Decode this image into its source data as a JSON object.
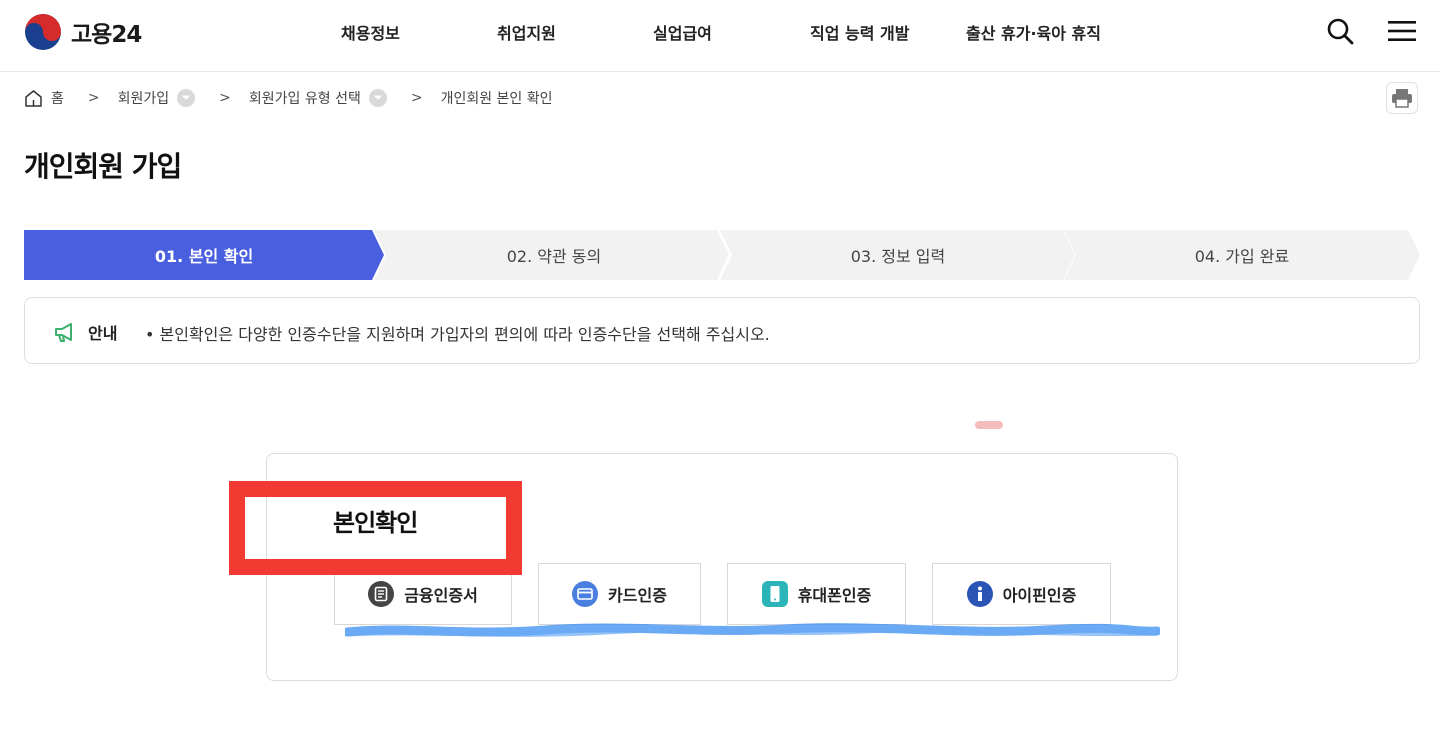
{
  "header": {
    "logo_text": "고용24",
    "nav": [
      {
        "label": "채용정보"
      },
      {
        "label": "취업지원"
      },
      {
        "label": "실업급여"
      },
      {
        "label": "직업 능력 개발"
      },
      {
        "label": "출산 휴가·육아 휴직"
      }
    ],
    "search_icon": "search-icon",
    "menu_icon": "hamburger-menu-icon"
  },
  "breadcrumb": {
    "home": "홈",
    "items": [
      {
        "label": "회원가입"
      },
      {
        "label": "회원가입 유형 선택"
      },
      {
        "label": "개인회원 본인 확인"
      }
    ]
  },
  "page": {
    "title": "개인회원 가입"
  },
  "steps": [
    {
      "label": "01. 본인 확인",
      "active": true
    },
    {
      "label": "02. 약관 동의",
      "active": false
    },
    {
      "label": "03. 정보 입력",
      "active": false
    },
    {
      "label": "04. 가입 완료",
      "active": false
    }
  ],
  "notice": {
    "label": "안내",
    "text": "• 본인확인은 다양한 인증수단을 지원하며 가입자의 편의에 따라 인증수단을 선택해 주십시오."
  },
  "verification": {
    "title": "본인확인",
    "methods": [
      {
        "label": "금융인증서",
        "icon": "certificate-icon"
      },
      {
        "label": "카드인증",
        "icon": "card-icon"
      },
      {
        "label": "휴대폰인증",
        "icon": "mobile-phone-icon"
      },
      {
        "label": "아이핀인증",
        "icon": "info-icon"
      }
    ]
  },
  "colors": {
    "accent": "#4a5fe0",
    "step_inactive": "#f2f2f2",
    "highlight": "#f03a32",
    "scribble": "#3a8ef0"
  }
}
